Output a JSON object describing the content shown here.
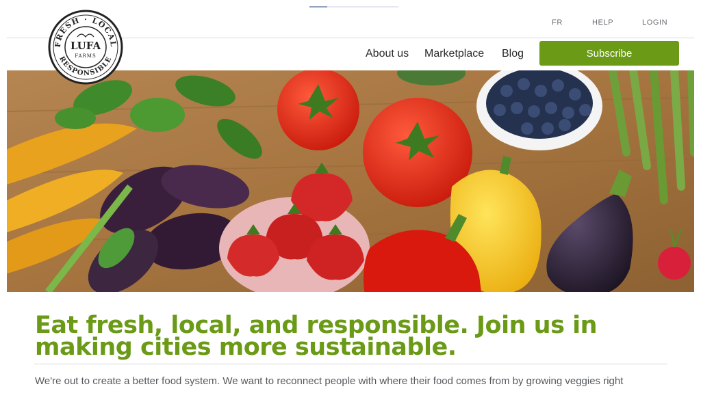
{
  "brand": {
    "logo_top": "FRESH · LOCAL",
    "logo_name": "LUFA",
    "logo_sub": "FARMS",
    "logo_bottom": "RESPONSIBLE"
  },
  "utility_nav": {
    "language": "FR",
    "help": "HELP",
    "login": "LOGIN"
  },
  "main_nav": {
    "about": "About us",
    "marketplace": "Marketplace",
    "blog": "Blog",
    "subscribe": "Subscribe"
  },
  "hero": {
    "icons": [
      "carrot",
      "herb-leaf",
      "tomato",
      "blueberry-bowl",
      "asparagus",
      "strawberry-bowl",
      "bell-pepper",
      "eggplant",
      "radish"
    ]
  },
  "content": {
    "headline": "Eat fresh, local, and responsible. Join us in making cities more sustainable.",
    "intro": "We're out to create a better food system. We want to reconnect people with where their food comes from by growing veggies right"
  },
  "colors": {
    "brand_green": "#6a9a16",
    "wood": "#a97a44"
  }
}
